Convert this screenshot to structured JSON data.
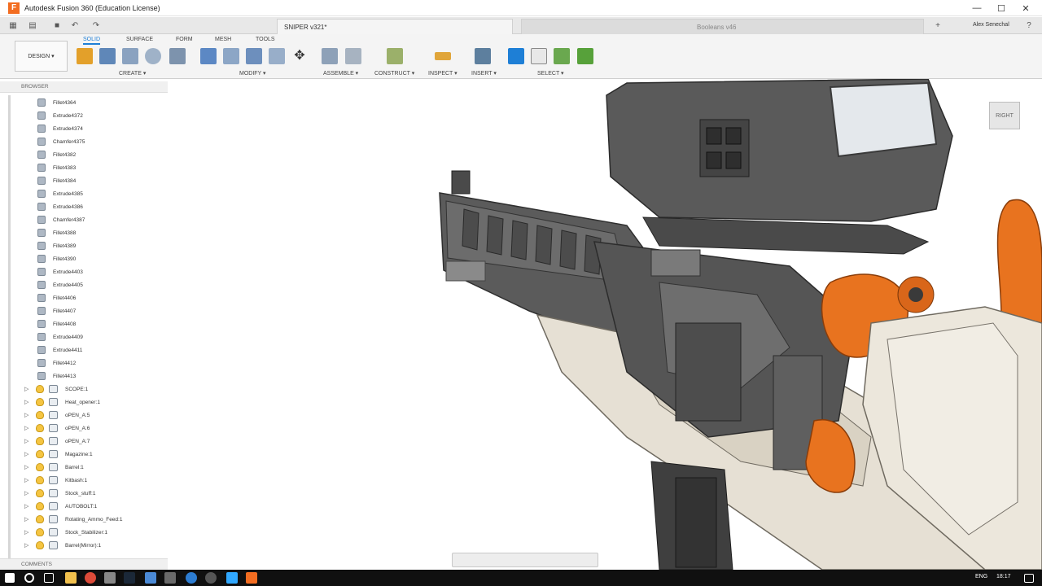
{
  "window": {
    "title": "Autodesk Fusion 360 (Education License)",
    "app_icon_letter": "F"
  },
  "tabs": {
    "active_doc": "SNIPER v321*",
    "inactive_doc": "Booleans v46",
    "user": "Alex Senechal"
  },
  "ribbon": {
    "workspace": "DESIGN ▾",
    "tabs": [
      "SOLID",
      "SURFACE",
      "FORM",
      "MESH",
      "TOOLS"
    ],
    "groups": [
      "CREATE ▾",
      "MODIFY ▾",
      "ASSEMBLE ▾",
      "CONSTRUCT ▾",
      "INSPECT ▾",
      "INSERT ▾",
      "SELECT ▾"
    ]
  },
  "browser": {
    "title": "BROWSER",
    "features": [
      "Fillet4364",
      "Extrude4372",
      "Extrude4374",
      "Chamfer4375",
      "Fillet4382",
      "Fillet4383",
      "Fillet4384",
      "Extrude4385",
      "Extrude4386",
      "Chamfer4387",
      "Fillet4388",
      "Fillet4389",
      "Fillet4390",
      "Extrude4403",
      "Extrude4405",
      "Fillet4406",
      "Fillet4407",
      "Fillet4408",
      "Extrude4409",
      "Extrude4411",
      "Fillet4412",
      "Fillet4413"
    ],
    "components": [
      "SCOPE:1",
      "Heat_opener:1",
      "oPEN_A:5",
      "oPEN_A:6",
      "oPEN_A:7",
      "Magazine:1",
      "Barrel:1",
      "Kitbash:1",
      "Stock_stuff:1",
      "AUTOBOLT:1",
      "Rotating_Ammo_Feed:1",
      "Stock_Stabilizer:1",
      "Barrel(Mirror):1"
    ]
  },
  "comments": {
    "title": "COMMENTS"
  },
  "viewcube": {
    "face": "RIGHT"
  },
  "taskbar": {
    "language": "ENG",
    "time": "18:17"
  },
  "colors": {
    "accent": "#1e7fd6",
    "gun_orange": "#e8731f",
    "gun_dark": "#4a4a4a",
    "gun_light": "#e6e0d4"
  }
}
